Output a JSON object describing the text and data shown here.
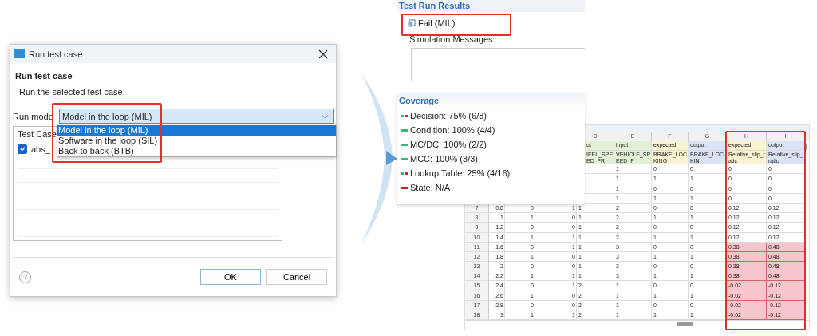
{
  "dialog": {
    "title": "Run test case",
    "heading": "Run test case",
    "description": "Run the selected test case.",
    "run_mode": {
      "label": "Run mode",
      "value": "Model in the loop (MIL)",
      "expanded": true,
      "options": [
        {
          "label": "Model in the loop (MIL)",
          "selected": true
        },
        {
          "label": "Software in the loop (SIL)",
          "selected": false
        },
        {
          "label": "Back to back (BTB)",
          "selected": false
        }
      ]
    },
    "test_cases": {
      "header": "Test Case",
      "rows": [
        {
          "label": "abs_",
          "checked": true
        }
      ]
    },
    "help": "?",
    "buttons": [
      {
        "label": "OK",
        "default": true
      },
      {
        "label": "Cancel",
        "default": false
      }
    ]
  },
  "results": {
    "title": "Test Run Results",
    "status": "Fail (MIL)",
    "messages_label": "Simulation Messages:"
  },
  "coverage": {
    "title": "Coverage",
    "items": [
      {
        "label": "Decision: 75% (6/8)",
        "color": "#c8232c",
        "partial": true
      },
      {
        "label": "Condition: 100% (4/4)",
        "color": "#3cb878",
        "partial": false
      },
      {
        "label": "MC/DC: 100% (2/2)",
        "color": "#3cb878",
        "partial": false
      },
      {
        "label": "MCC: 100% (3/3)",
        "color": "#3cb878",
        "partial": false
      },
      {
        "label": "Lookup Table: 25% (4/16)",
        "color": "#c8232c",
        "partial": true
      },
      {
        "label": "State: N/A",
        "color": "#c8232c",
        "partial": false
      }
    ]
  },
  "sheet": {
    "columns": [
      {},
      {},
      {},
      {
        "letter": "D",
        "kind": "input",
        "name": "ut",
        "signal": "IEEL_SPEED_FR"
      },
      {
        "letter": "E",
        "kind": "input",
        "name": "input",
        "signal": "VEHICLE_SPEED_F"
      },
      {
        "letter": "F",
        "kind": "expected",
        "name": "expected",
        "signal": "BRAKE_LOCKING"
      },
      {
        "letter": "G",
        "kind": "output",
        "name": "output",
        "signal": "BRAKE_LOCKIN"
      },
      {
        "letter": "H",
        "kind": "expected",
        "name": "expected",
        "signal": "Relative_slip_ratic"
      },
      {
        "letter": "I",
        "kind": "output",
        "name": "output",
        "signal": "Relative_slip_ratic"
      }
    ],
    "rows": [
      {
        "cells": [
          null,
          null,
          null,
          null,
          "1",
          "0",
          "0",
          "0",
          "0"
        ],
        "mismatch": false
      },
      {
        "cells": [
          null,
          null,
          null,
          null,
          "1",
          "1",
          "1",
          "0",
          "0"
        ],
        "mismatch": false
      },
      {
        "cells": [
          null,
          null,
          null,
          null,
          "1",
          "0",
          "0",
          "0",
          "0"
        ],
        "mismatch": false
      },
      {
        "cells": [
          null,
          null,
          null,
          null,
          "1",
          "1",
          "1",
          "0",
          "0"
        ],
        "mismatch": false
      },
      {
        "number": "7",
        "cells": [
          "0.8",
          "0",
          "1",
          "1",
          "2",
          "0",
          "0",
          "0.12",
          "0.12"
        ],
        "mismatch": false
      },
      {
        "number": "8",
        "cells": [
          "1",
          "1",
          "0",
          "1",
          "2",
          "1",
          "1",
          "0.12",
          "0.12"
        ],
        "mismatch": false
      },
      {
        "number": "9",
        "cells": [
          "1.2",
          "0",
          "0",
          "1",
          "2",
          "0",
          "0",
          "0.12",
          "0.12"
        ],
        "mismatch": false
      },
      {
        "number": "10",
        "cells": [
          "1.4",
          "1",
          "1",
          "1",
          "2",
          "1",
          "1",
          "0.12",
          "0.12"
        ],
        "mismatch": false
      },
      {
        "number": "11",
        "cells": [
          "1.6",
          "0",
          "1",
          "1",
          "3",
          "0",
          "0",
          "0.38",
          "0.48"
        ],
        "mismatch": true
      },
      {
        "number": "12",
        "cells": [
          "1.8",
          "1",
          "0",
          "1",
          "3",
          "1",
          "1",
          "0.38",
          "0.48"
        ],
        "mismatch": true
      },
      {
        "number": "13",
        "cells": [
          "2",
          "0",
          "0",
          "1",
          "3",
          "0",
          "0",
          "0.38",
          "0.48"
        ],
        "mismatch": true
      },
      {
        "number": "14",
        "cells": [
          "2.2",
          "1",
          "1",
          "1",
          "3",
          "1",
          "1",
          "0.38",
          "0.48"
        ],
        "mismatch": true
      },
      {
        "number": "15",
        "cells": [
          "2.4",
          "0",
          "1",
          "2",
          "1",
          "0",
          "0",
          "-0.02",
          "-0.12"
        ],
        "mismatch": true
      },
      {
        "number": "16",
        "cells": [
          "2.6",
          "1",
          "0",
          "2",
          "1",
          "1",
          "1",
          "-0.02",
          "-0.12"
        ],
        "mismatch": true
      },
      {
        "number": "17",
        "cells": [
          "2.8",
          "0",
          "0",
          "2",
          "1",
          "0",
          "0",
          "-0.02",
          "-0.12"
        ],
        "mismatch": true
      },
      {
        "number": "18",
        "cells": [
          "3",
          "1",
          "1",
          "2",
          "1",
          "1",
          "1",
          "-0.02",
          "-0.12"
        ],
        "mismatch": true
      }
    ]
  }
}
